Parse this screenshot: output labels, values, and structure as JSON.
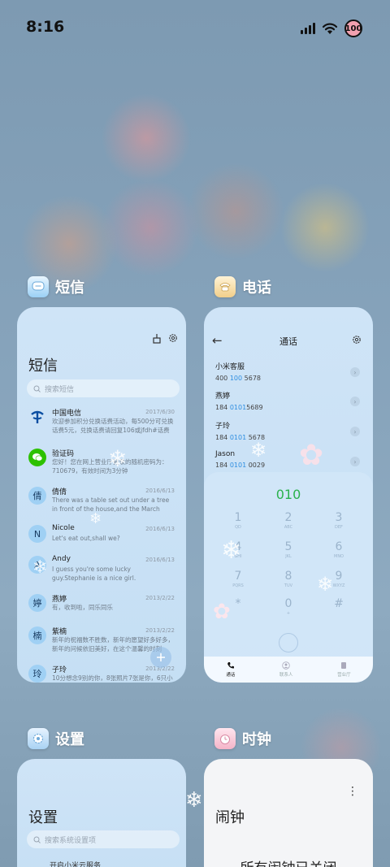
{
  "status_bar": {
    "time": "8:16",
    "battery": "100"
  },
  "apps": {
    "messages": {
      "label": "短信",
      "title": "短信",
      "search_placeholder": "搜索短信",
      "threads": [
        {
          "name": "中国电信",
          "date": "2017/6/30",
          "preview": "欢迎参加积分兑换话费活动，每500分可兑换话费5元，兑换话费请回复106或jfdh#话费",
          "avatar": "telecom-logo",
          "avatar_color": "#0a4ea2"
        },
        {
          "name": "验证码",
          "date": "",
          "preview": "您好！您在网上营业厅登录的随机密码为：710679，有效时间为3分钟",
          "avatar": "wechat-icon",
          "avatar_color": "#2dc100"
        },
        {
          "name": "倩倩",
          "date": "2016/6/13",
          "preview": "There was a table set out under a tree in front of the house,and the March Hare an",
          "avatar": "倩",
          "avatar_color": "#9fd0f4"
        },
        {
          "name": "Nicole",
          "date": "2016/6/13",
          "preview": "Let's eat out,shall we?",
          "avatar": "N",
          "avatar_color": "#9fd0f4"
        },
        {
          "name": "Andy",
          "date": "2016/6/13",
          "preview": "I guess you're some lucky guy.Stephanie is a nice girl.",
          "avatar": "A",
          "avatar_color": "#9fd0f4"
        },
        {
          "name": "燕婷",
          "date": "2013/2/22",
          "preview": "有，收到啦，同乐同乐",
          "avatar": "婷",
          "avatar_color": "#9fd0f4"
        },
        {
          "name": "紫楠",
          "date": "2013/2/22",
          "preview": "新年的祝福数不胜数，新年的愿望好多好多，新年的问候依旧美好，在这个温馨的时刻",
          "avatar": "楠",
          "avatar_color": "#9fd0f4"
        },
        {
          "name": "子玲",
          "date": "2013/2/22",
          "preview": "10分想念9别的你，8张照片7张是你，6只小鸟5只像你，4根骨头3根给你，2只",
          "avatar": "玲",
          "avatar_color": "#9fd0f4"
        }
      ]
    },
    "phone": {
      "label": "电话",
      "title": "通话",
      "contacts": [
        {
          "name": "小米客服",
          "num_pre": "400 ",
          "num_hl": "100",
          "num_post": " 5678"
        },
        {
          "name": "燕婷",
          "num_pre": "184 ",
          "num_hl": "0101",
          "num_post": "5689"
        },
        {
          "name": "子玲",
          "num_pre": "184 ",
          "num_hl": "0101",
          "num_post": " 5678"
        },
        {
          "name": "Jason",
          "num_pre": "184 ",
          "num_hl": "0101",
          "num_post": " 0029"
        }
      ],
      "dial_input": "010",
      "keys": [
        {
          "d": "1",
          "l": "QD"
        },
        {
          "d": "2",
          "l": "ABC"
        },
        {
          "d": "3",
          "l": "DEF"
        },
        {
          "d": "4",
          "l": "GHI"
        },
        {
          "d": "5",
          "l": "JKL"
        },
        {
          "d": "6",
          "l": "MNO"
        },
        {
          "d": "7",
          "l": "PQRS"
        },
        {
          "d": "8",
          "l": "TUV"
        },
        {
          "d": "9",
          "l": "WXYZ"
        },
        {
          "d": "*",
          "l": ""
        },
        {
          "d": "0",
          "l": "+"
        },
        {
          "d": "#",
          "l": ""
        }
      ],
      "tabs": [
        {
          "label": "通话",
          "icon": "phone-icon",
          "active": true
        },
        {
          "label": "联系人",
          "icon": "person-icon",
          "active": false
        },
        {
          "label": "营业厅",
          "icon": "store-icon",
          "active": false
        }
      ]
    },
    "settings": {
      "label": "设置",
      "title": "设置",
      "search_placeholder": "搜索系统设置项",
      "first_item": "开启小米云服务"
    },
    "clock": {
      "label": "时钟",
      "title": "闹钟",
      "empty_text": "所有闹钟已关闭"
    }
  }
}
